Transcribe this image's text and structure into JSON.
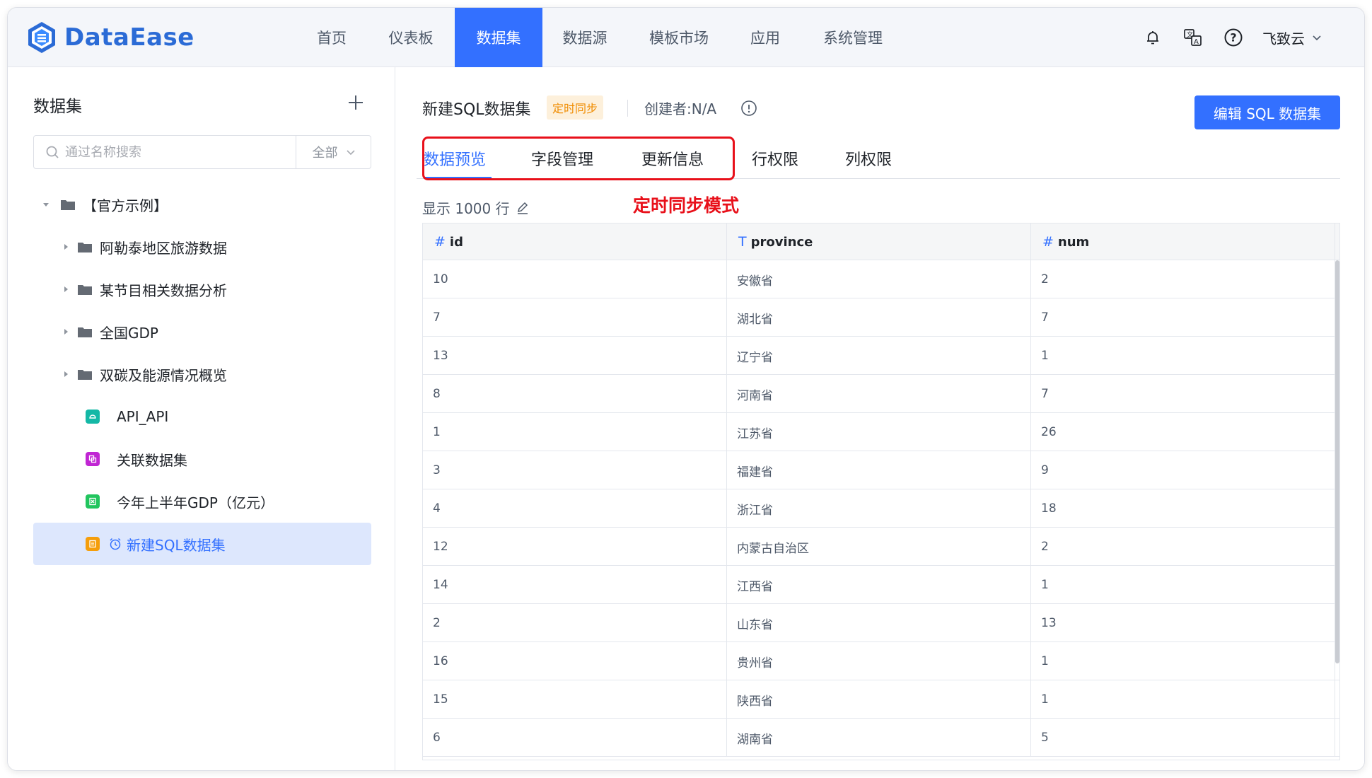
{
  "app": {
    "name": "DataEase",
    "brand_color": "#3370ff"
  },
  "nav": {
    "items": [
      "首页",
      "仪表板",
      "数据集",
      "数据源",
      "模板市场",
      "应用",
      "系统管理"
    ],
    "active_index": 2
  },
  "header": {
    "user": "飞致云"
  },
  "sidebar": {
    "title": "数据集",
    "search": {
      "placeholder": "通过名称搜索",
      "filter": "全部"
    },
    "tree": [
      {
        "label": "【官方示例】",
        "type": "folder",
        "expanded": true,
        "level": 0
      },
      {
        "label": "阿勒泰地区旅游数据",
        "type": "folder",
        "level": 1
      },
      {
        "label": "某节目相关数据分析",
        "type": "folder",
        "level": 1
      },
      {
        "label": "全国GDP",
        "type": "folder",
        "level": 1
      },
      {
        "label": "双碳及能源情况概览",
        "type": "folder",
        "level": 1
      },
      {
        "label": "API_API",
        "type": "dataset-api",
        "color": "#14b8a6",
        "level": 1
      },
      {
        "label": "关联数据集",
        "type": "dataset-union",
        "color": "#c026d3",
        "level": 1
      },
      {
        "label": "今年上半年GDP（亿元）",
        "type": "dataset-excel",
        "color": "#22c55e",
        "level": 1
      },
      {
        "label": "新建SQL数据集",
        "type": "dataset-sql",
        "color": "#f59e0b",
        "level": 1,
        "selected": true,
        "scheduled": true
      }
    ]
  },
  "dataset": {
    "name": "新建SQL数据集",
    "tag": "定时同步",
    "creator": "创建者:N/A",
    "edit_button": "编辑 SQL 数据集",
    "tabs": [
      "数据预览",
      "字段管理",
      "更新信息",
      "行权限",
      "列权限"
    ],
    "active_tab": 0,
    "annotation": "定时同步模式",
    "rows_info": "显示 1000 行"
  },
  "table": {
    "columns": [
      {
        "type_icon": "#",
        "name": "id"
      },
      {
        "type_icon": "T",
        "name": "province"
      },
      {
        "type_icon": "#",
        "name": "num"
      }
    ],
    "rows": [
      [
        "10",
        "安徽省",
        "2"
      ],
      [
        "7",
        "湖北省",
        "7"
      ],
      [
        "13",
        "辽宁省",
        "1"
      ],
      [
        "8",
        "河南省",
        "7"
      ],
      [
        "1",
        "江苏省",
        "26"
      ],
      [
        "3",
        "福建省",
        "9"
      ],
      [
        "4",
        "浙江省",
        "18"
      ],
      [
        "12",
        "内蒙古自治区",
        "2"
      ],
      [
        "14",
        "江西省",
        "1"
      ],
      [
        "2",
        "山东省",
        "13"
      ],
      [
        "16",
        "贵州省",
        "1"
      ],
      [
        "15",
        "陕西省",
        "1"
      ],
      [
        "6",
        "湖南省",
        "5"
      ]
    ]
  }
}
